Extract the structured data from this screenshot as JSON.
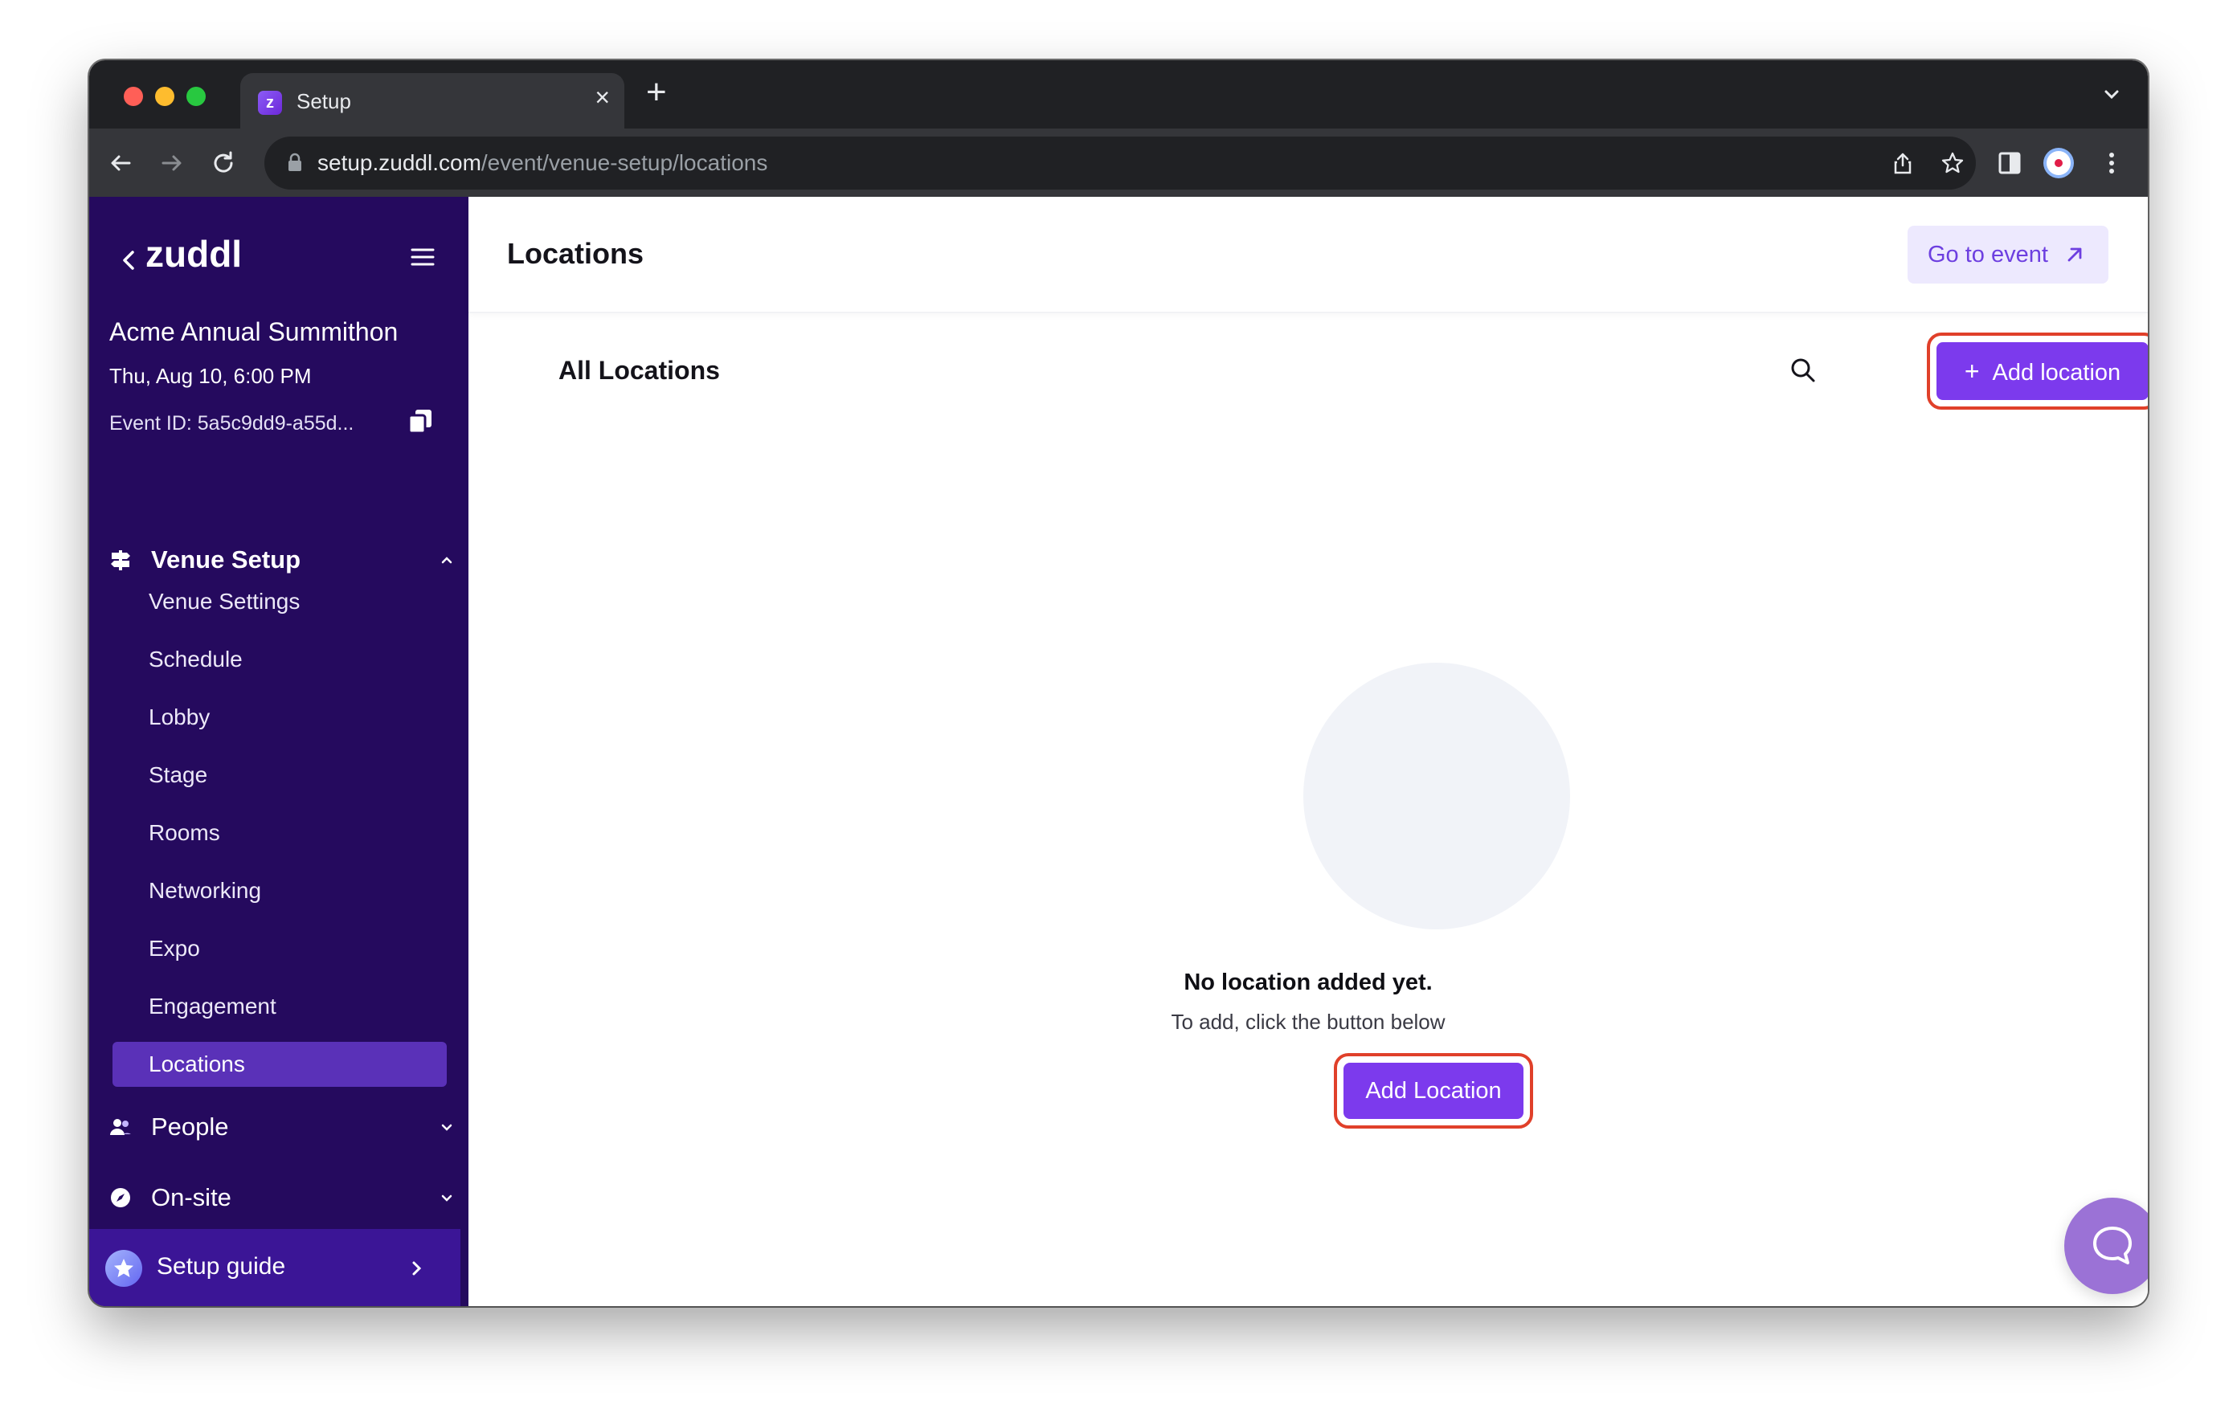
{
  "browser": {
    "tab_title": "Setup",
    "tab_favicon_letter": "z",
    "url_host": "setup.zuddl.com",
    "url_path": "/event/venue-setup/locations"
  },
  "sidebar": {
    "brand": "zuddl",
    "event_name": "Acme Annual Summithon",
    "event_date": "Thu, Aug 10, 6:00 PM",
    "event_id": "Event ID: 5a5c9dd9-a55d...",
    "venue_setup": {
      "label": "Venue Setup",
      "items": [
        {
          "label": "Venue Settings"
        },
        {
          "label": "Schedule"
        },
        {
          "label": "Lobby"
        },
        {
          "label": "Stage"
        },
        {
          "label": "Rooms"
        },
        {
          "label": "Networking"
        },
        {
          "label": "Expo"
        },
        {
          "label": "Engagement"
        },
        {
          "label": "Locations"
        }
      ]
    },
    "people_label": "People",
    "onsite_label": "On-site",
    "setup_guide_label": "Setup guide"
  },
  "main": {
    "page_title": "Locations",
    "go_to_event_label": "Go to event",
    "section_title": "All Locations",
    "add_location_label": "Add location",
    "add_location_plus": "+",
    "empty_title": "No location added yet.",
    "empty_subtitle": "To add, click the button below",
    "add_location_bottom_label": "Add Location"
  },
  "colors": {
    "sidebar_bg": "#250a5e",
    "accent": "#7c3aed",
    "active_item": "#5a31b8",
    "highlight_ring": "#e0402a"
  }
}
